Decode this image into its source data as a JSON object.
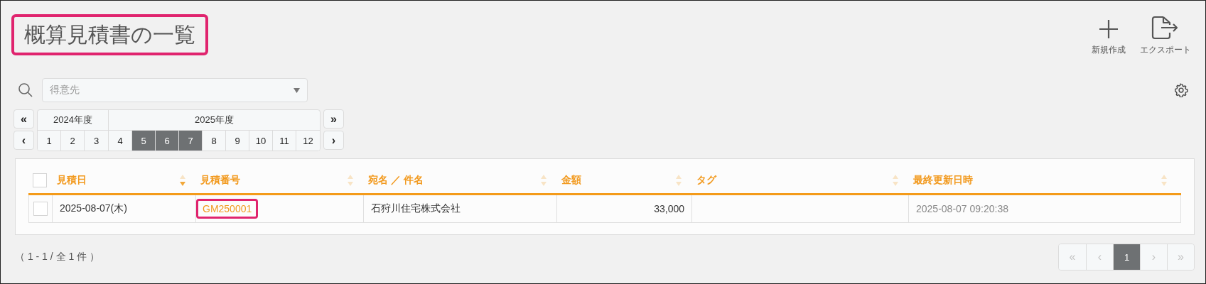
{
  "title": {
    "text": "概算見積書の一覧",
    "highlighted": true
  },
  "toolbar": [
    {
      "kind": "plus",
      "label": "新規作成"
    },
    {
      "kind": "export",
      "label": "エクスポート"
    }
  ],
  "filter": {
    "placeholder": "得意先"
  },
  "calendar": {
    "prev_year": "«",
    "prev": "‹",
    "next_year": "»",
    "next": "›",
    "years": [
      {
        "label": "2024年度",
        "months": [
          {
            "label": "1",
            "selected": false
          },
          {
            "label": "2",
            "selected": false
          },
          {
            "label": "3",
            "selected": false
          }
        ]
      },
      {
        "label": "2025年度",
        "months": [
          {
            "label": "4",
            "selected": false
          },
          {
            "label": "5",
            "selected": true
          },
          {
            "label": "6",
            "selected": true
          },
          {
            "label": "7",
            "selected": true
          },
          {
            "label": "8",
            "selected": false
          },
          {
            "label": "9",
            "selected": false
          },
          {
            "label": "10",
            "selected": false
          },
          {
            "label": "11",
            "selected": false
          },
          {
            "label": "12",
            "selected": false
          }
        ]
      }
    ]
  },
  "table": {
    "columns": [
      {
        "label": "見積日",
        "sorted_descending": true
      },
      {
        "label": "見積番号",
        "sorted_descending": false
      },
      {
        "label": "宛名 ／ 件名",
        "sorted_descending": false
      },
      {
        "label": "金額",
        "sorted_descending": false
      },
      {
        "label": "タグ",
        "sorted_descending": false
      },
      {
        "label": "最終更新日時",
        "sorted_descending": false
      }
    ],
    "header_checked": false,
    "rows": [
      {
        "checked": false,
        "cells": [
          {
            "kind": "text",
            "text": "2025-08-07(木)"
          },
          {
            "kind": "link",
            "text": "GM250001",
            "highlighted": true
          },
          {
            "kind": "text",
            "text": "石狩川住宅株式会社"
          },
          {
            "kind": "number",
            "text": "33,000"
          },
          {
            "kind": "empty"
          },
          {
            "kind": "muted",
            "text": "2025-08-07 09:20:38"
          }
        ]
      }
    ]
  },
  "footer": {
    "count": "（ 1 - 1 / 全 1 件 ）",
    "pager": [
      {
        "label": "«",
        "disabled": true,
        "selected": false
      },
      {
        "label": "‹",
        "disabled": true,
        "selected": false
      },
      {
        "label": "1",
        "disabled": false,
        "selected": true
      },
      {
        "label": "›",
        "disabled": true,
        "selected": false
      },
      {
        "label": "»",
        "disabled": true,
        "selected": false
      }
    ]
  }
}
